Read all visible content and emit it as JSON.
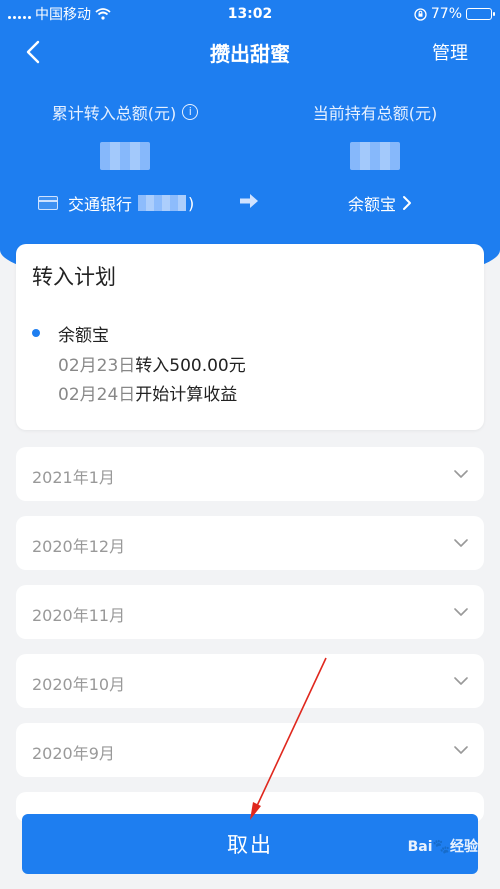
{
  "status": {
    "carrier": "中国移动",
    "time": "13:02",
    "battery": "77%",
    "battery_level": 0.77
  },
  "nav": {
    "title": "攒出甜蜜",
    "manage": "管理"
  },
  "summary": {
    "total_in_label": "累计转入总额(元)",
    "holding_label": "当前持有总额(元)"
  },
  "flow": {
    "source_bank": "交通银行",
    "source_suffix": ")",
    "destination": "余额宝"
  },
  "plan": {
    "title": "转入计划",
    "product": "余额宝",
    "line1_date": "02月23日",
    "line1_text": "转入500.00元",
    "line2_date": "02月24日",
    "line2_text": "开始计算收益"
  },
  "months": [
    "2021年1月",
    "2020年12月",
    "2020年11月",
    "2020年10月",
    "2020年9月"
  ],
  "action": {
    "withdraw": "取出"
  },
  "watermark": "Bai🐾经验"
}
